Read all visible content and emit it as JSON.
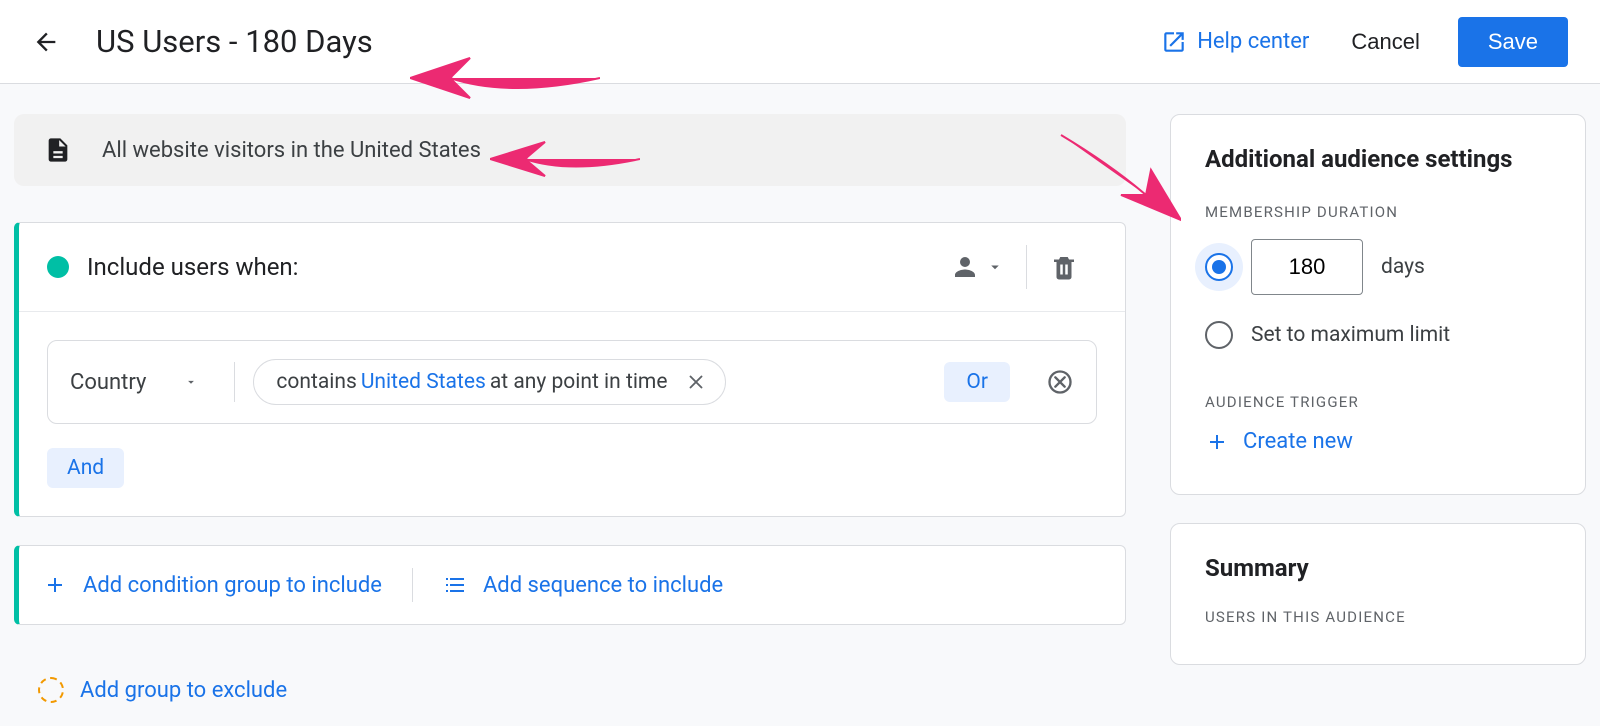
{
  "header": {
    "title": "US Users - 180 Days",
    "help": "Help center",
    "cancel": "Cancel",
    "save": "Save"
  },
  "description": "All website visitors in the United States",
  "include": {
    "heading": "Include users when:",
    "dimension": "Country",
    "pill_prefix": "contains ",
    "pill_value": "United States",
    "pill_suffix": " at any point in time",
    "or": "Or",
    "and": "And"
  },
  "add_links": {
    "condition_group": "Add condition group to include",
    "sequence": "Add sequence to include"
  },
  "exclude": "Add group to exclude",
  "settings": {
    "title": "Additional audience settings",
    "membership_label": "MEMBERSHIP DURATION",
    "duration_value": "180",
    "days": "days",
    "max_limit": "Set to maximum limit",
    "trigger_label": "AUDIENCE TRIGGER",
    "create_new": "Create new"
  },
  "summary": {
    "title": "Summary",
    "users_label": "USERS IN THIS AUDIENCE"
  }
}
